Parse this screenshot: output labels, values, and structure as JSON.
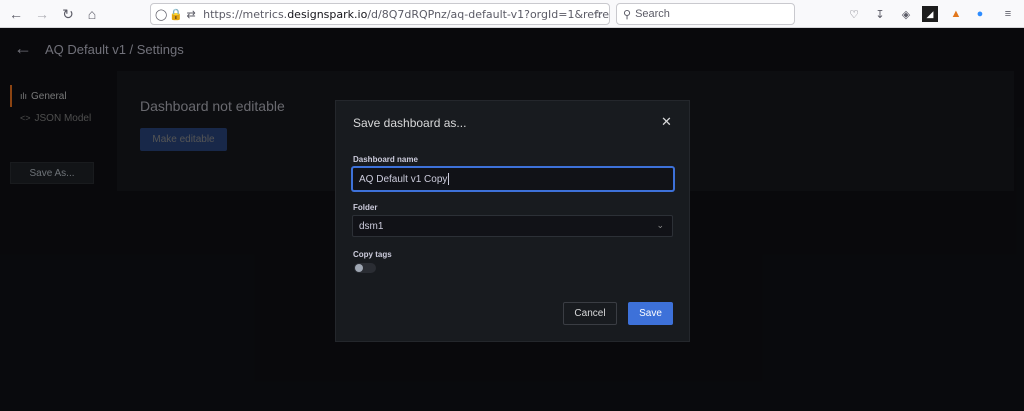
{
  "browser": {
    "url_prefix": "https://metrics.",
    "url_domain": "designspark.io",
    "url_rest": "/d/8Q7dRQPnz/aq-default-v1?orgId=1&refre",
    "search_placeholder": "Search",
    "icons": [
      "back-arrow-icon",
      "forward-arrow-icon",
      "reload-icon",
      "home-icon",
      "shield-icon",
      "lock-icon",
      "permissions-icon",
      "bookmark-star-icon",
      "search-icon",
      "pocket-icon",
      "download-icon",
      "extension-icon",
      "extension-dark-icon",
      "metamask-icon",
      "zoom-icon",
      "menu-icon"
    ]
  },
  "header": {
    "title": "AQ Default v1 / Settings"
  },
  "sidebar": {
    "items": [
      {
        "label": "General",
        "glyph": "ılı",
        "active": true
      },
      {
        "label": "JSON Model",
        "glyph": "<>",
        "active": false
      }
    ],
    "save_as_label": "Save As..."
  },
  "main": {
    "heading": "Dashboard not editable",
    "make_editable_label": "Make editable"
  },
  "modal": {
    "title": "Save dashboard as...",
    "name_label": "Dashboard name",
    "name_value": "AQ Default v1 Copy",
    "folder_label": "Folder",
    "folder_value": "dsm1",
    "copy_tags_label": "Copy tags",
    "copy_tags_on": false,
    "cancel_label": "Cancel",
    "save_label": "Save"
  },
  "colors": {
    "accent": "#3d71d9",
    "active_indicator": "#ff7c22",
    "background": "#111217",
    "panel": "#181b1f"
  }
}
